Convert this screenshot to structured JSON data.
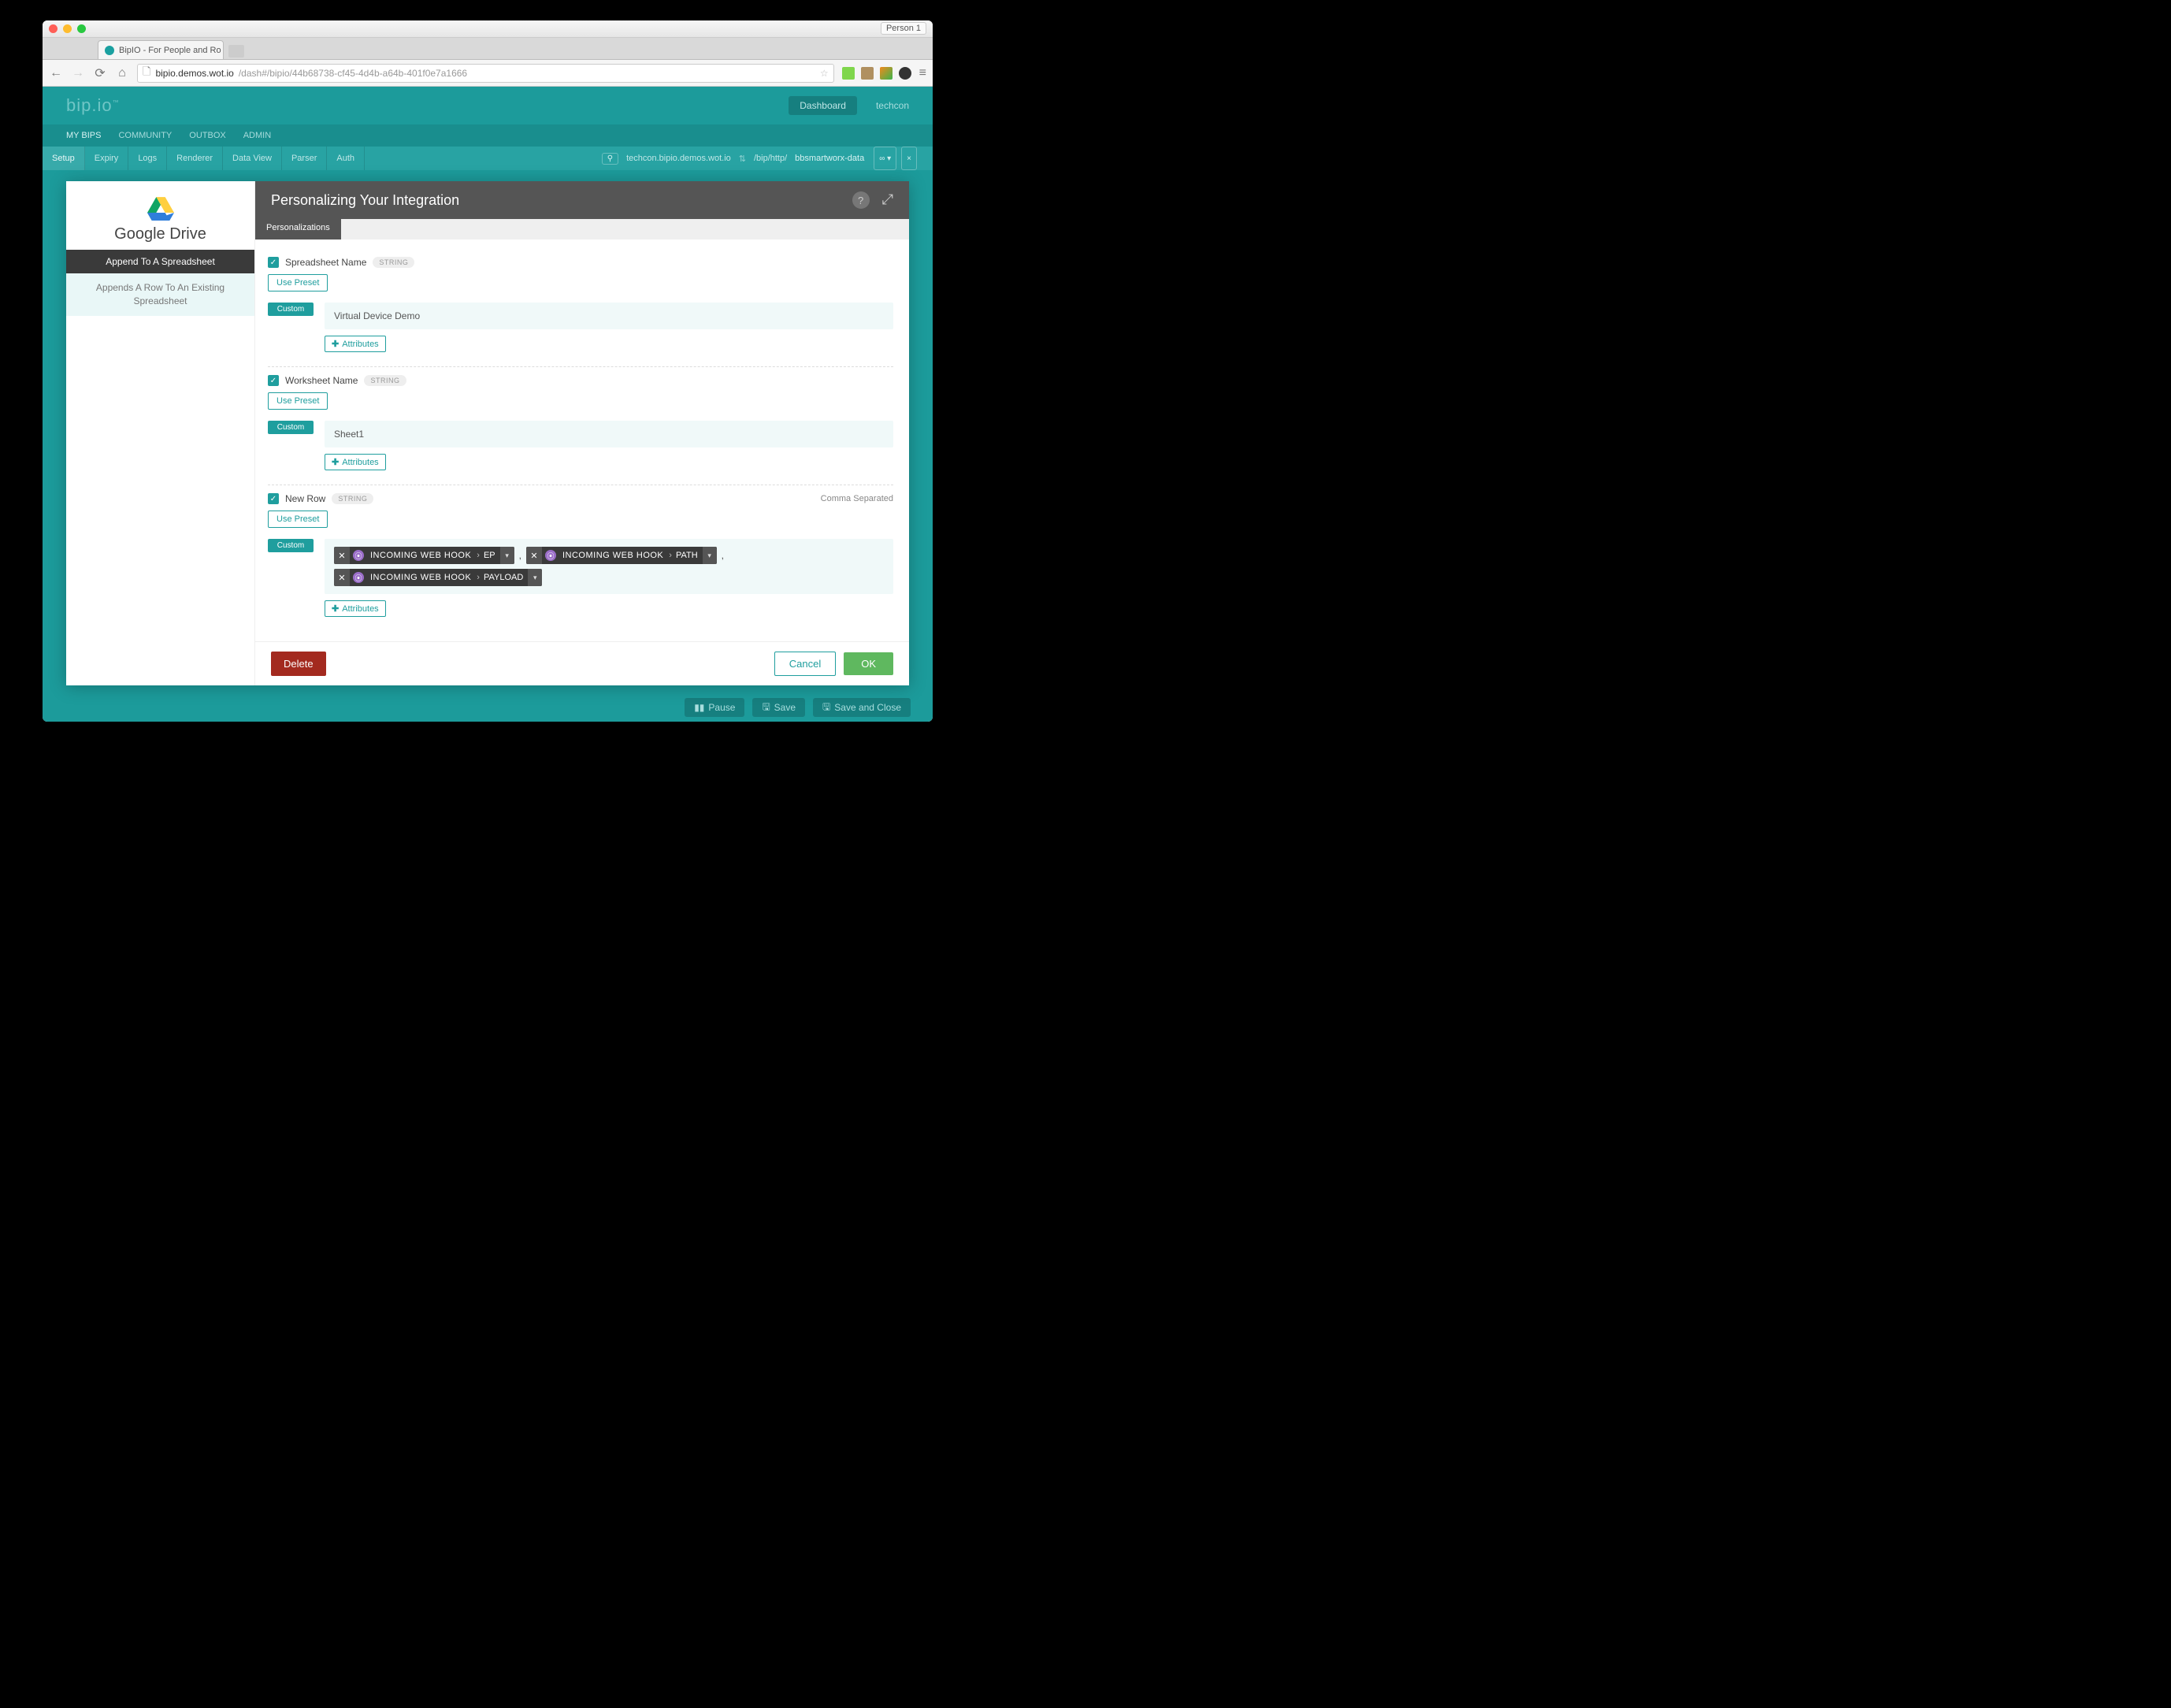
{
  "browser": {
    "tab_title": "BipIO - For People and Ro",
    "person": "Person 1",
    "url_domain": "bipio.demos.wot.io",
    "url_path": "/dash#/bipio/44b68738-cf45-4d4b-a64b-401f0e7a1666"
  },
  "app": {
    "brand_a": "bip",
    "brand_b": ".io",
    "dashboard": "Dashboard",
    "user": "techcon"
  },
  "nav1": {
    "items": [
      "MY BIPS",
      "COMMUNITY",
      "OUTBOX",
      "ADMIN"
    ],
    "active_index": 0
  },
  "nav2": {
    "subtabs": [
      "Setup",
      "Expiry",
      "Logs",
      "Renderer",
      "Data View",
      "Parser",
      "Auth"
    ],
    "active_index": 0,
    "host": "techcon.bipio.demos.wot.io",
    "path_prefix": "/bip/http/",
    "path_value": "bbsmartworx-data"
  },
  "panel": {
    "service": "Google Drive",
    "action": "Append To A Spreadsheet",
    "action_desc": "Appends A Row To An Existing Spreadsheet",
    "title": "Personalizing Your Integration",
    "tab": "Personalizations",
    "use_preset": "Use Preset",
    "custom": "Custom",
    "attributes": "Attributes",
    "delete": "Delete",
    "cancel": "Cancel",
    "ok": "OK"
  },
  "fields": {
    "spreadsheet": {
      "label": "Spreadsheet Name",
      "type": "STRING",
      "value": "Virtual Device Demo"
    },
    "worksheet": {
      "label": "Worksheet Name",
      "type": "STRING",
      "value": "Sheet1"
    },
    "newrow": {
      "label": "New Row",
      "type": "STRING",
      "hint": "Comma Separated",
      "tokens": [
        {
          "source": "INCOMING WEB HOOK",
          "field": "EP"
        },
        {
          "source": "INCOMING WEB HOOK",
          "field": "PATH"
        },
        {
          "source": "INCOMING WEB HOOK",
          "field": "PAYLOAD"
        }
      ]
    }
  },
  "bottom": {
    "pause": "Pause",
    "save": "Save",
    "save_close": "Save and Close"
  }
}
